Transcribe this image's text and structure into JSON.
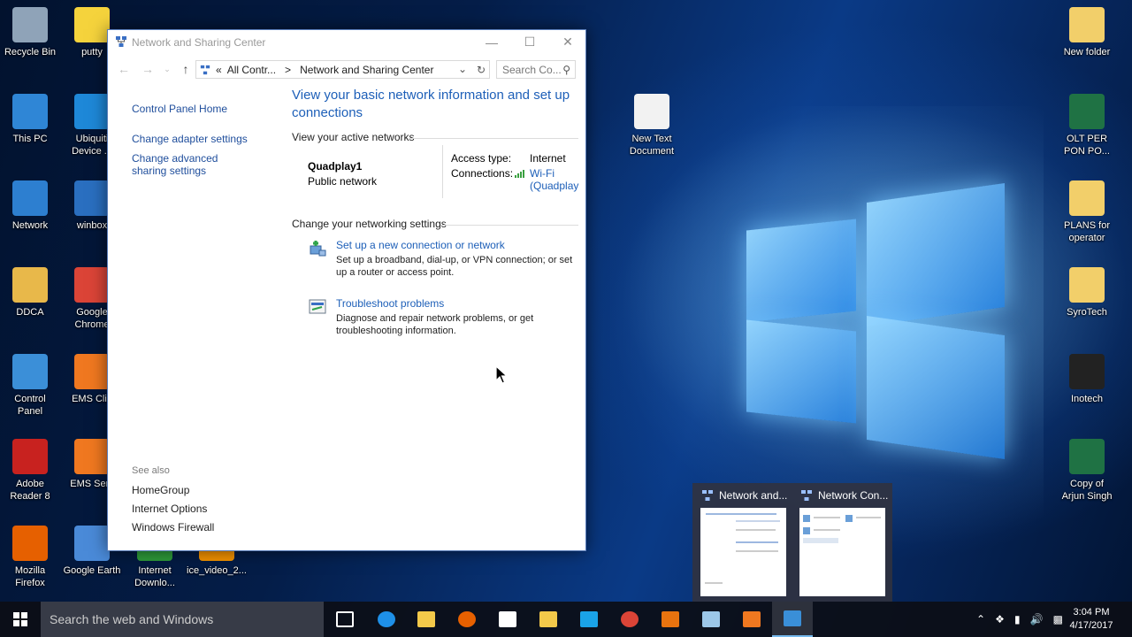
{
  "desktop_icons_left": [
    {
      "label": "Recycle Bin",
      "icon": "recycle-bin-icon",
      "color": "#8fa3b8"
    },
    {
      "label": "This PC",
      "icon": "computer-icon",
      "color": "#2f86d6"
    },
    {
      "label": "Network",
      "icon": "network-globe-icon",
      "color": "#2d7fd0"
    },
    {
      "label": "DDCA",
      "icon": "user-folder-icon",
      "color": "#e8b84a"
    },
    {
      "label": "Control\nPanel",
      "icon": "control-panel-icon",
      "color": "#3b8fd8"
    },
    {
      "label": "Adobe\nReader 8",
      "icon": "adobe-reader-icon",
      "color": "#c8221f"
    },
    {
      "label": "Mozilla\nFirefox",
      "icon": "firefox-icon",
      "color": "#e66000"
    }
  ],
  "desktop_icons_col2": [
    {
      "label": "putty",
      "icon": "putty-icon",
      "color": "#f5d33c"
    },
    {
      "label": "Ubiquiti\nDevice ...",
      "icon": "ubiquiti-icon",
      "color": "#1e88d8"
    },
    {
      "label": "winbox",
      "icon": "winbox-icon",
      "color": "#2a6fc0"
    },
    {
      "label": "Google\nChrome",
      "icon": "chrome-icon",
      "color": "#db4437"
    },
    {
      "label": "EMS Clie",
      "icon": "ems-client-icon",
      "color": "#f07820"
    },
    {
      "label": "EMS Serv",
      "icon": "ems-server-icon",
      "color": "#f07820"
    },
    {
      "label": "Google Earth",
      "icon": "google-earth-icon",
      "color": "#4a8ad8"
    }
  ],
  "desktop_icons_bottom": [
    {
      "label": "Internet\nDownlo...",
      "icon": "internet-download-icon",
      "color": "#2e9a3a"
    },
    {
      "label": "ice_video_2...",
      "icon": "vlc-icon",
      "color": "#f39200"
    }
  ],
  "desktop_icons_middle": [
    {
      "label": "New Text\nDocument",
      "icon": "text-document-icon",
      "color": "#f2f2f2"
    }
  ],
  "desktop_icons_right": [
    {
      "label": "New folder",
      "icon": "folder-icon",
      "color": "#f2cf6a"
    },
    {
      "label": "OLT PER\nPON PO...",
      "icon": "excel-icon",
      "color": "#1f7244"
    },
    {
      "label": "PLANS for\noperator",
      "icon": "folder-icon",
      "color": "#f2cf6a"
    },
    {
      "label": "SyroTech",
      "icon": "folder-icon",
      "color": "#f2cf6a"
    },
    {
      "label": "Inotech",
      "icon": "folder-dark-icon",
      "color": "#222222"
    },
    {
      "label": "Copy of\nArjun Singh",
      "icon": "excel-icon",
      "color": "#1f7244"
    }
  ],
  "window": {
    "title": "Network and Sharing Center",
    "address": {
      "chevron": "«",
      "crumb1": "All Contr...",
      "separator": ">",
      "crumb2": "Network and Sharing Center"
    },
    "search_placeholder": "Search Co...",
    "left_links": [
      "Control Panel Home",
      "Change adapter settings",
      "Change advanced sharing settings"
    ],
    "see_also": {
      "heading": "See also",
      "links": [
        "HomeGroup",
        "Internet Options",
        "Windows Firewall"
      ]
    },
    "heading": "View your basic network information and set up connections",
    "active_networks_label": "View your active networks",
    "network": {
      "name": "Quadplay1",
      "type": "Public network",
      "access_type_label": "Access type:",
      "access_type_value": "Internet",
      "connections_label": "Connections:",
      "connection_value_line1": "Wi-Fi",
      "connection_value_line2": "(Quadplay"
    },
    "change_settings_label": "Change your networking settings",
    "tasks": [
      {
        "link": "Set up a new connection or network",
        "desc": "Set up a broadband, dial-up, or VPN connection; or set up a router or access point."
      },
      {
        "link": "Troubleshoot problems",
        "desc": "Diagnose and repair network problems, or get troubleshooting information."
      }
    ]
  },
  "thumbnails": [
    {
      "title": "Network and..."
    },
    {
      "title": "Network Con..."
    }
  ],
  "taskbar": {
    "search_placeholder": "Search the web and Windows",
    "apps": [
      "task-view-icon",
      "edge-icon",
      "file-explorer-icon",
      "firefox-icon",
      "store-icon",
      "folder-icon",
      "skype-icon",
      "chrome-icon",
      "outlook-icon",
      "notepad-icon",
      "ems-icon",
      "control-panel-icon"
    ],
    "time": "3:04 PM",
    "date": "4/17/2017"
  },
  "colors": {
    "link_blue": "#1d5fb8",
    "nav_link": "#1f4e9c"
  }
}
